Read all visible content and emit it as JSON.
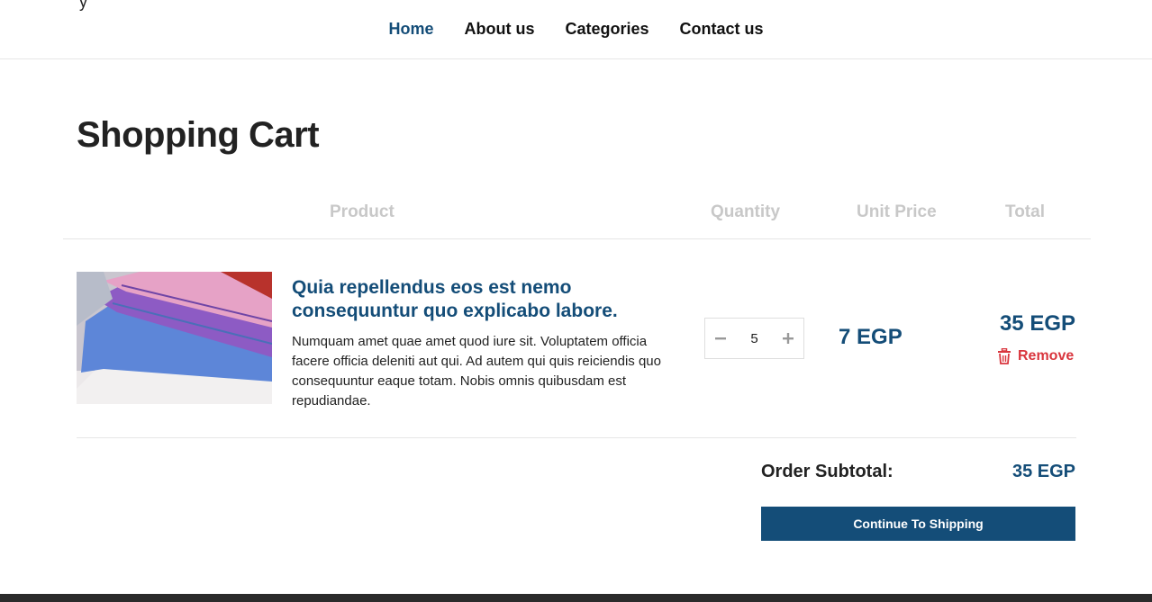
{
  "header": {
    "logo_fragment": "y",
    "nav": [
      {
        "label": "Home",
        "active": true
      },
      {
        "label": "About us",
        "active": false
      },
      {
        "label": "Categories",
        "active": false
      },
      {
        "label": "Contact us",
        "active": false
      }
    ]
  },
  "page": {
    "title": "Shopping Cart"
  },
  "cart": {
    "columns": {
      "product": "Product",
      "quantity": "Quantity",
      "unit_price": "Unit Price",
      "total": "Total"
    },
    "items": [
      {
        "title": "Quia repellendus eos est nemo consequuntur quo explicabo labore.",
        "description": "Numquam amet quae amet quod iure sit. Voluptatem officia facere officia deleniti aut qui. Ad autem qui quis reiciendis quo consequuntur eaque totam. Nobis omnis quibusdam est repudiandae.",
        "quantity": "5",
        "unit_price": "7 EGP",
        "total": "35 EGP",
        "remove_label": "Remove",
        "image_icon": "folded-towels-image"
      }
    ],
    "subtotal_label": "Order Subtotal:",
    "subtotal_value": "35 EGP",
    "continue_label": "Continue To Shipping"
  },
  "colors": {
    "brand": "#144d78",
    "danger": "#d9363e",
    "muted_header": "#c8c8c8",
    "footer": "#2b2b2b"
  },
  "icons": {
    "minus": "minus-icon",
    "plus": "plus-icon",
    "trash": "trash-icon"
  }
}
